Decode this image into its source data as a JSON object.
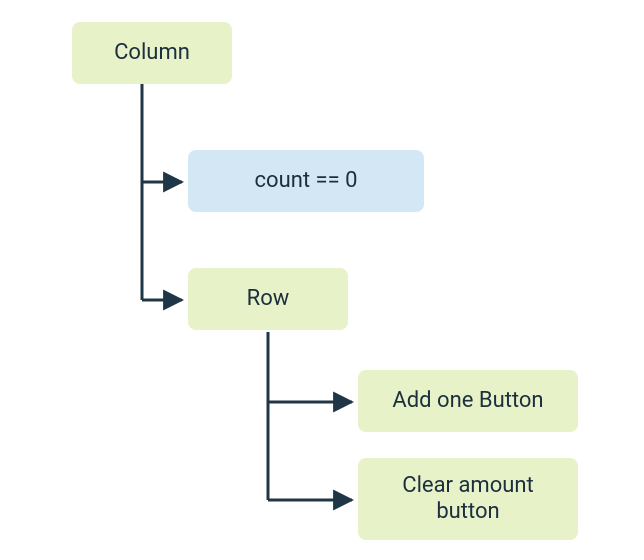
{
  "nodes": {
    "column": {
      "label": "Column"
    },
    "count_cond": {
      "label": "count == 0"
    },
    "row": {
      "label": "Row"
    },
    "add_button": {
      "label": "Add one Button"
    },
    "clear_button": {
      "label": "Clear amount button"
    }
  },
  "colors": {
    "green": "#e8f2c8",
    "blue": "#d3e7f5",
    "line": "#1f3646"
  }
}
